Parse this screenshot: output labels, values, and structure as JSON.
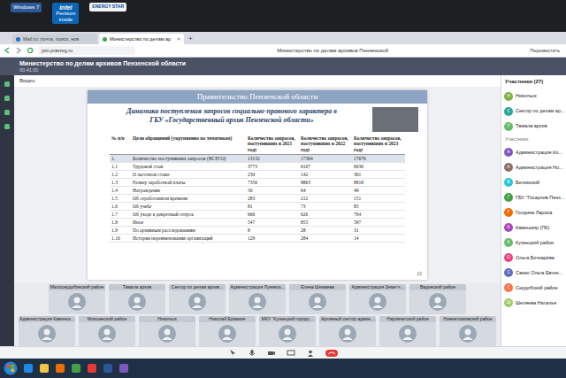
{
  "bezel": {
    "stickers": [
      {
        "kind": "windows",
        "lines": [
          "Windows 7"
        ]
      },
      {
        "kind": "intel",
        "lines": [
          "intel",
          "Pentium",
          "inside"
        ]
      },
      {
        "kind": "energy",
        "lines": [
          "ENERGY STAR"
        ]
      }
    ]
  },
  "browser": {
    "tabs": [
      {
        "label": "Mail.ru: почта, поиск, нов",
        "selected": false
      },
      {
        "label": "Министерство по делам ар",
        "selected": true
      }
    ],
    "close": "×",
    "new_tab": "+",
    "url": "join.pravreg.ru",
    "page_title": "Министерство по делам архивов Пензенской",
    "right_action": "Переместить"
  },
  "header": {
    "title": "Министерство по делам архивов Пензенской области",
    "timer": "00:41:00"
  },
  "video_label": "Видео",
  "slide": {
    "banner": "Правительство Пензенской области",
    "title": "Динамика поступления запросов социально-правового характера в ГБУ «Государственный архив Пензенской области»",
    "columns": [
      "№ п/п",
      "Цели обращений (укрупненно по тематикам)",
      "Количество запросов, поступивших в 2021 году",
      "Количество запросов, поступивших в 2022 году",
      "Количество запросов, поступивших в 2023 году"
    ],
    "rows": [
      [
        "1.",
        "Количество поступивших запросов (ВСЕГО)",
        "13132",
        "17304",
        "17676"
      ],
      [
        "1.1",
        "Трудовой стаж",
        "3773",
        "6167",
        "6636"
      ],
      [
        "1.2",
        "О льготном стаже",
        "230",
        "142",
        "301"
      ],
      [
        "1.3",
        "Размер заработной платы",
        "7356",
        "8863",
        "8818"
      ],
      [
        "1.4",
        "Награждение",
        "56",
        "64",
        "49"
      ],
      [
        "1.5",
        "Об отработанном времени",
        "283",
        "212",
        "151"
      ],
      [
        "1.6",
        "Об учебе",
        "81",
        "73",
        "85"
      ],
      [
        "1.7",
        "Об уходе в декретный отпуск",
        "666",
        "626",
        "764"
      ],
      [
        "1.8",
        "Иное",
        "547",
        "855",
        "597"
      ],
      [
        "1.9",
        "По архивным расследованиям",
        "8",
        "28",
        "31"
      ],
      [
        "1.10",
        "История переименования организаций",
        "129",
        "284",
        "14"
      ]
    ],
    "page_number": "22"
  },
  "tile_rows": [
    [
      "Малосердобинский район",
      "Тамала архив",
      "Сектор по делам архив...",
      "Администрация Лунинск...",
      "Елена Шемаева",
      "Администрация Земетч...",
      "Вадинский район"
    ],
    [
      "Администрация Каменск...",
      "Мокшанский район",
      "Никольск",
      "Николай Ермакин",
      "МКУ \"Кузнецкий городс...",
      "Архивный сектор админ...",
      "Наровчатский район",
      "Нижнеломовский район"
    ]
  ],
  "participants": {
    "title": "Участники (27)",
    "pinned": [
      {
        "name": "Никольск",
        "initial": "Н",
        "color": "#7cb342"
      },
      {
        "name": "Сектор по делам ар...",
        "initial": "С",
        "color": "#26a69a"
      },
      {
        "name": "Тамала архив",
        "initial": "Т",
        "color": "#66bb6a"
      }
    ],
    "section": "Участники",
    "items": [
      {
        "name": "Администрация Ко...",
        "initial": "А",
        "color": "#7e57c2"
      },
      {
        "name": "Администрация Но...",
        "initial": "А",
        "color": "#8d6e63"
      },
      {
        "name": "Белинский",
        "initial": "Б",
        "color": "#26c6da"
      },
      {
        "name": "ГБУ \"Госархив Пенз...",
        "initial": "Г",
        "color": "#43a047"
      },
      {
        "name": "Голдина Лариса",
        "initial": "Г",
        "color": "#ef6c00"
      },
      {
        "name": "Камешкир (ПК)",
        "initial": "К",
        "color": "#ab47bc"
      },
      {
        "name": "Кузнецкий район",
        "initial": "К",
        "color": "#66bb6a"
      },
      {
        "name": "Ольга Бочкарёва",
        "initial": "О",
        "color": "#ec407a"
      },
      {
        "name": "Санко Ольга Евген...",
        "initial": "С",
        "color": "#5c6bc0"
      },
      {
        "name": "Сердобский район",
        "initial": "С",
        "color": "#ff7043"
      },
      {
        "name": "Шеляева Наталья",
        "initial": "Ш",
        "color": "#9ccc65"
      }
    ]
  }
}
